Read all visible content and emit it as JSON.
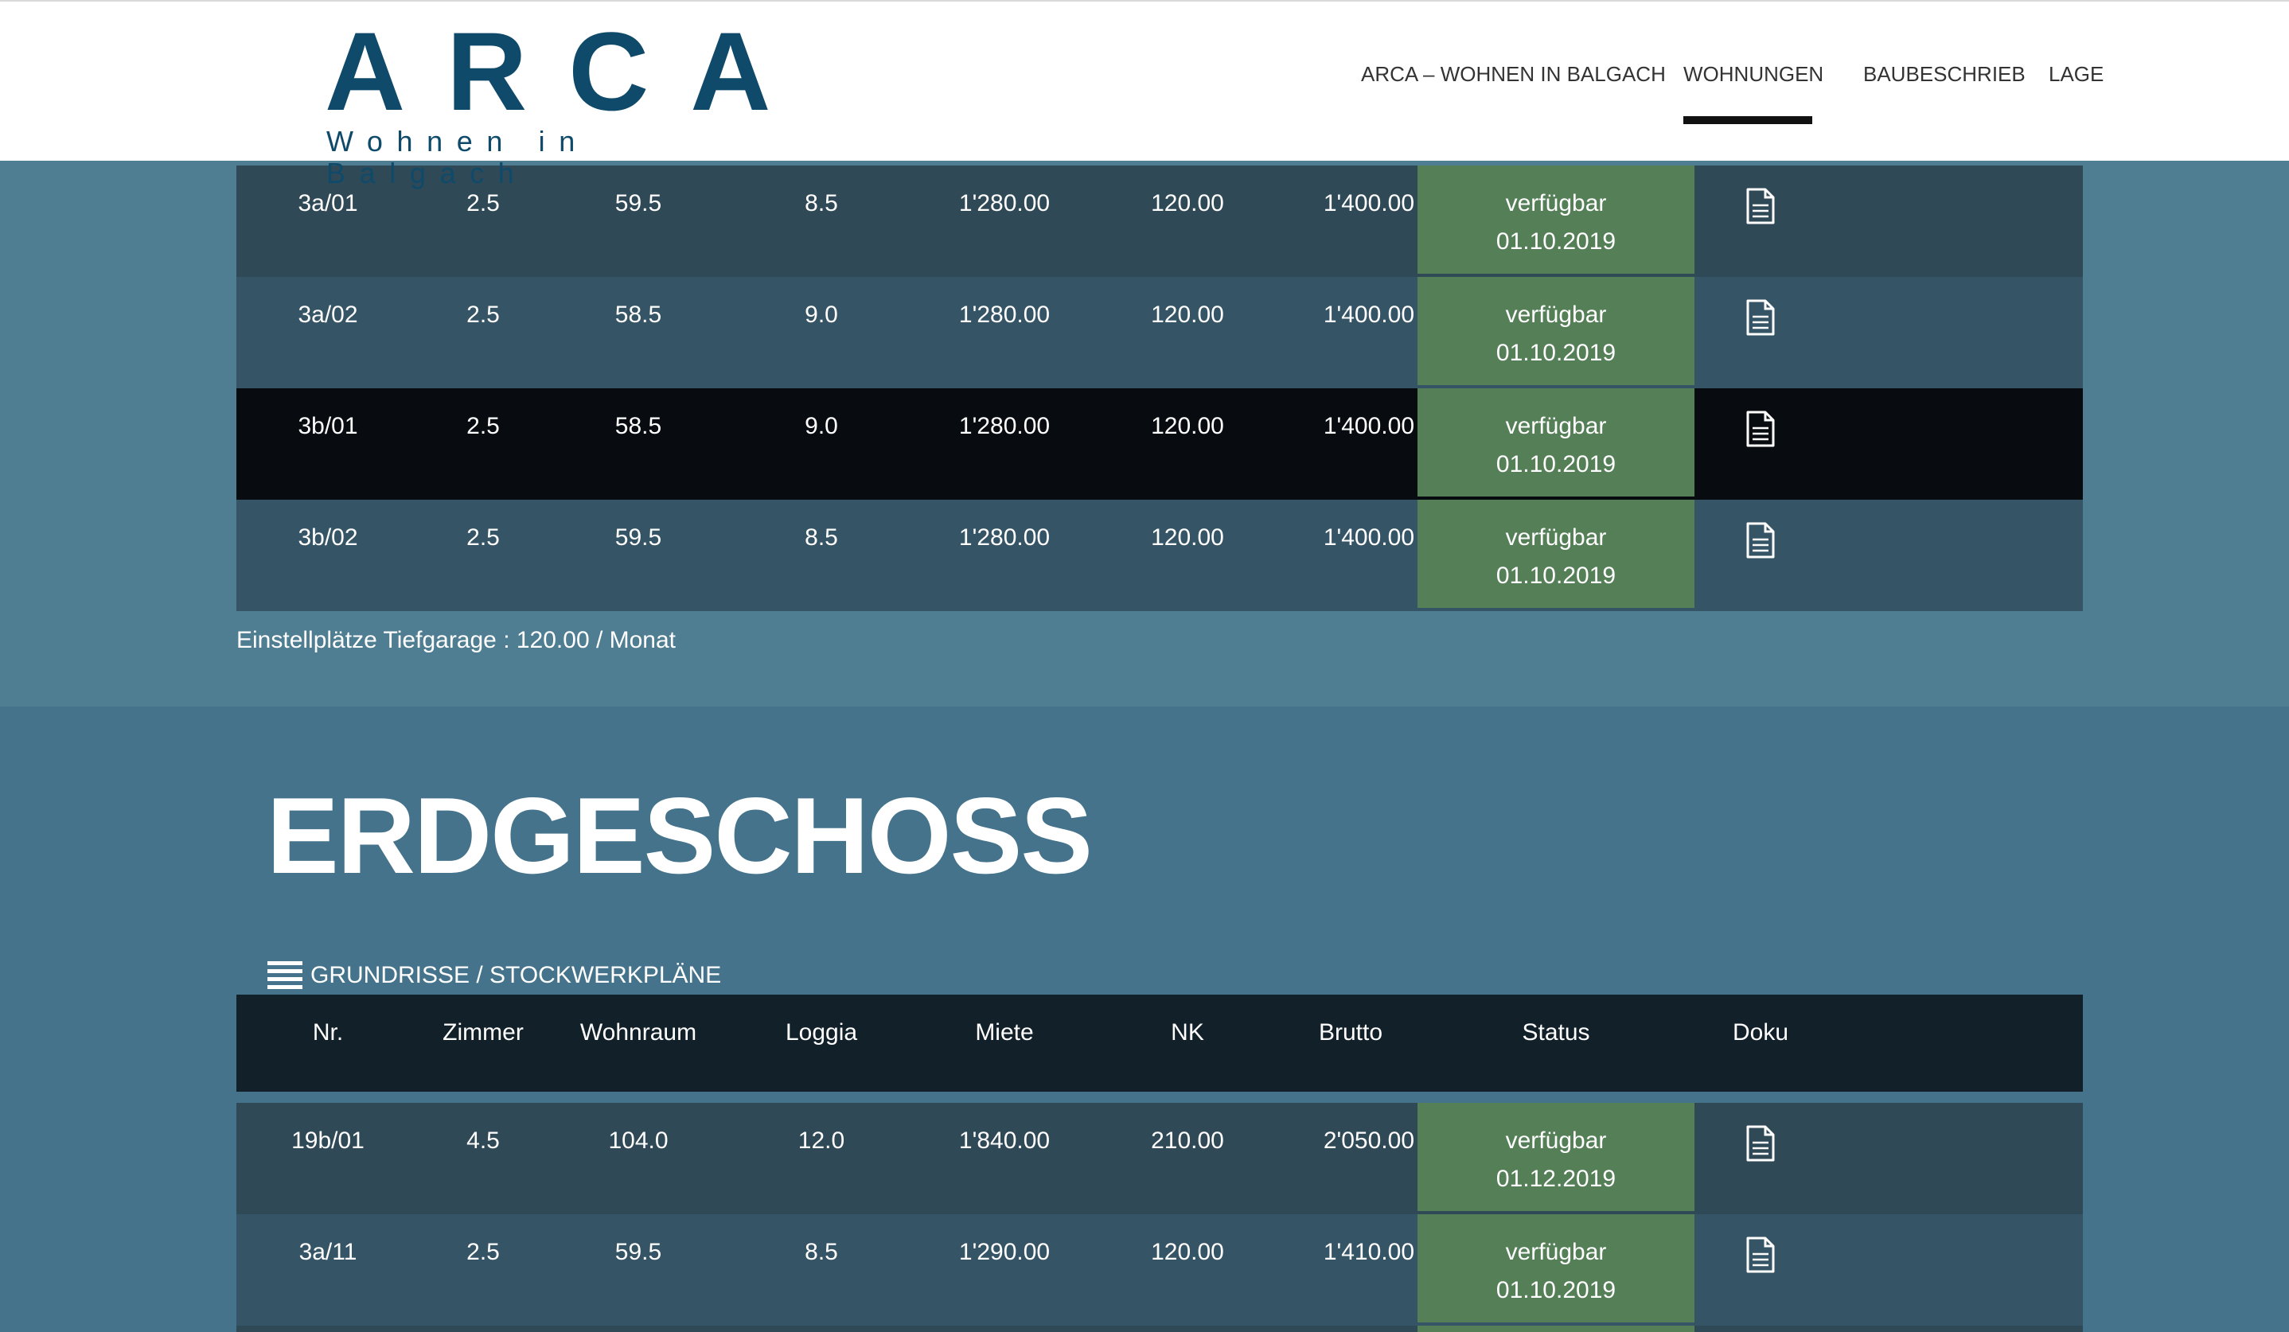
{
  "logo": {
    "title": "ARCA",
    "subtitle": "Wohnen in Balgach"
  },
  "nav": {
    "items": [
      {
        "label": "ARCA – WOHNEN IN BALGACH",
        "active": false
      },
      {
        "label": "WOHNUNGEN",
        "active": true
      },
      {
        "label": "BAUBESCHRIEB",
        "active": false
      },
      {
        "label": "LAGE",
        "active": false
      }
    ]
  },
  "upper_table": {
    "rows": [
      {
        "nr": "3a/01",
        "zimmer": "2.5",
        "wohnraum": "59.5",
        "loggia": "8.5",
        "miete": "1'280.00",
        "nk": "120.00",
        "brutto": "1'400.00",
        "status": "verfügbar",
        "date": "01.10.2019"
      },
      {
        "nr": "3a/02",
        "zimmer": "2.5",
        "wohnraum": "58.5",
        "loggia": "9.0",
        "miete": "1'280.00",
        "nk": "120.00",
        "brutto": "1'400.00",
        "status": "verfügbar",
        "date": "01.10.2019"
      },
      {
        "nr": "3b/01",
        "zimmer": "2.5",
        "wohnraum": "58.5",
        "loggia": "9.0",
        "miete": "1'280.00",
        "nk": "120.00",
        "brutto": "1'400.00",
        "status": "verfügbar",
        "date": "01.10.2019"
      },
      {
        "nr": "3b/02",
        "zimmer": "2.5",
        "wohnraum": "59.5",
        "loggia": "8.5",
        "miete": "1'280.00",
        "nk": "120.00",
        "brutto": "1'400.00",
        "status": "verfügbar",
        "date": "01.10.2019"
      }
    ],
    "garage_note": "Einstellplätze Tiefgarage : 120.00 / Monat"
  },
  "erdgeschoss": {
    "title": "ERDGESCHOSS",
    "plans_link": "GRUNDRISSE / STOCKWERKPLÄNE",
    "headers": {
      "nr": "Nr.",
      "zimmer": "Zimmer",
      "wohnraum": "Wohnraum",
      "loggia": "Loggia",
      "miete": "Miete",
      "nk": "NK",
      "brutto": "Brutto",
      "status": "Status",
      "doku": "Doku"
    },
    "rows": [
      {
        "nr": "19b/01",
        "zimmer": "4.5",
        "wohnraum": "104.0",
        "loggia": "12.0",
        "miete": "1'840.00",
        "nk": "210.00",
        "brutto": "2'050.00",
        "status": "verfügbar",
        "date": "01.12.2019"
      },
      {
        "nr": "3a/11",
        "zimmer": "2.5",
        "wohnraum": "59.5",
        "loggia": "8.5",
        "miete": "1'290.00",
        "nk": "120.00",
        "brutto": "1'410.00",
        "status": "verfügbar",
        "date": "01.10.2019"
      }
    ]
  },
  "colors": {
    "brand": "#0f4a6a",
    "status_available": "#557f57",
    "band_top": "#4f7d92",
    "band_bottom": "#44738b",
    "table_header": "#122029"
  },
  "icons": {
    "doc": "document-icon",
    "plans": "list-icon"
  }
}
